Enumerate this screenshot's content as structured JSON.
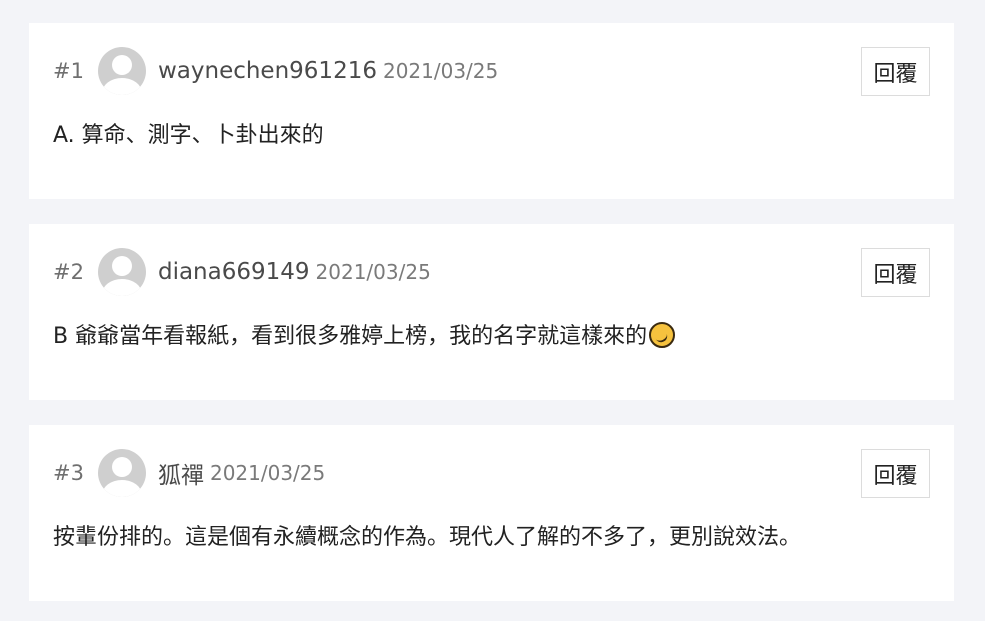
{
  "reply_label": "回覆",
  "comments": [
    {
      "floor": "#1",
      "username": "waynechen961216",
      "date": "2021/03/25",
      "content": "A. 算命、測字、卜卦出來的"
    },
    {
      "floor": "#2",
      "username": "diana669149",
      "date": "2021/03/25",
      "content": "B 爺爺當年看報紙，看到很多雅婷上榜，我的名字就這樣來的",
      "trailing_icon": "rolling-on-floor-laughing-emoji"
    },
    {
      "floor": "#3",
      "username": "狐禪",
      "date": "2021/03/25",
      "content": "按輩份排的。這是個有永續概念的作為。現代人了解的不多了，更別說效法。"
    }
  ],
  "colors": {
    "page_background": "#f3f4f8",
    "card_background": "#ffffff",
    "avatar_gray": "#cfcfcf"
  }
}
